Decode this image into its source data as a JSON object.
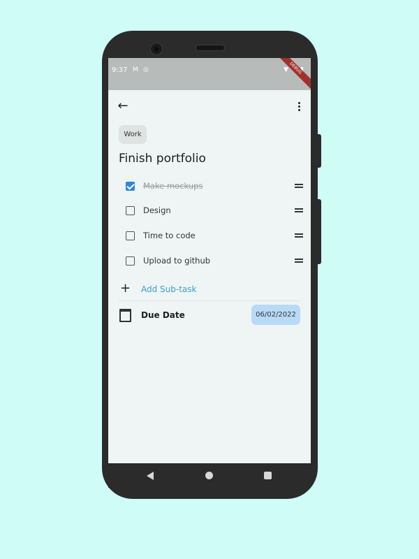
{
  "status_bar": {
    "time": "9:37",
    "icons": [
      "gmail-icon",
      "sync-icon",
      "wifi-icon",
      "battery-icon"
    ]
  },
  "debug_banner": "DEBUG",
  "app_bar": {
    "back_icon": "arrow-back-icon",
    "menu_icon": "more-vert-icon"
  },
  "task": {
    "category": "Work",
    "title": "Finish portfolio",
    "subtasks": [
      {
        "label": "Make mockups",
        "done": true
      },
      {
        "label": "Design",
        "done": false
      },
      {
        "label": "Time to code",
        "done": false
      },
      {
        "label": "Upload to github",
        "done": false
      }
    ],
    "add_subtask_label": "Add Sub-task",
    "due_date_label": "Due Date",
    "due_date_value": "06/02/2022"
  },
  "colors": {
    "background": "#cffcf7",
    "accent": "#3c9fd1",
    "checkbox_checked": "#2f86de",
    "date_chip": "#b8daf7"
  }
}
